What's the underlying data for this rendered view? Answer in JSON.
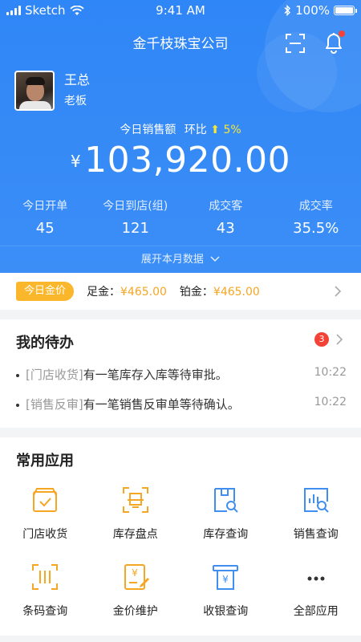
{
  "status_bar": {
    "carrier": "Sketch",
    "time": "9:41 AM",
    "battery": "100%"
  },
  "header": {
    "title": "金千枝珠宝公司"
  },
  "profile": {
    "name": "王总",
    "role": "老板"
  },
  "sales": {
    "label": "今日销售额",
    "compare_label": "环比",
    "compare_value": "5%",
    "currency": "¥",
    "amount": "103,920.00"
  },
  "stats": [
    {
      "label": "今日开单",
      "value": "45"
    },
    {
      "label": "今日到店(组)",
      "value": "121"
    },
    {
      "label": "成交客",
      "value": "43"
    },
    {
      "label": "成交率",
      "value": "35.5%"
    }
  ],
  "expand_label": "展开本月数据",
  "gold_price": {
    "tag": "今日金价",
    "items": [
      {
        "label": "足金：",
        "price": "¥465.00"
      },
      {
        "label": "铂金：",
        "price": "¥465.00"
      }
    ]
  },
  "todo": {
    "title": "我的待办",
    "badge": "3",
    "items": [
      {
        "category": "[门店收货]",
        "message": "有一笔库存入库等待审批。",
        "time": "10:22"
      },
      {
        "category": "[销售反审]",
        "message": "有一笔销售反审单等待确认。",
        "time": "10:22"
      }
    ]
  },
  "apps": {
    "title": "常用应用",
    "items": [
      {
        "label": "门店收货",
        "icon": "store-receive-icon"
      },
      {
        "label": "库存盘点",
        "icon": "inventory-check-icon"
      },
      {
        "label": "库存查询",
        "icon": "inventory-query-icon"
      },
      {
        "label": "销售查询",
        "icon": "sales-query-icon"
      },
      {
        "label": "条码查询",
        "icon": "barcode-query-icon"
      },
      {
        "label": "金价维护",
        "icon": "gold-price-edit-icon"
      },
      {
        "label": "收银查询",
        "icon": "cashier-query-icon"
      },
      {
        "label": "全部应用",
        "icon": "more-icon"
      }
    ]
  },
  "colors": {
    "primary": "#3388f7",
    "orange": "#f5a623",
    "blue_icon": "#3f8ef0",
    "badge": "#f44336",
    "gold_tag": "#fbb72c"
  }
}
